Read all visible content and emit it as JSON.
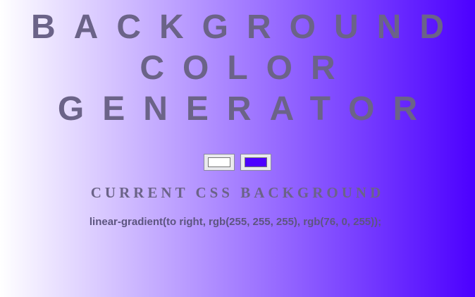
{
  "header": {
    "title_lines": [
      "BACKGROUND",
      "COLOR",
      "GENERATOR"
    ]
  },
  "pickers": {
    "color1": {
      "value": "#ffffff"
    },
    "color2": {
      "value": "#4c00ff"
    }
  },
  "section": {
    "heading": "CURRENT CSS BACKGROUND"
  },
  "output": {
    "css_text": "linear-gradient(to right, rgb(255, 255, 255), rgb(76, 0, 255));"
  },
  "colors": {
    "gradient_start": "#ffffff",
    "gradient_end": "#4c00ff",
    "text": "#6b6388"
  }
}
